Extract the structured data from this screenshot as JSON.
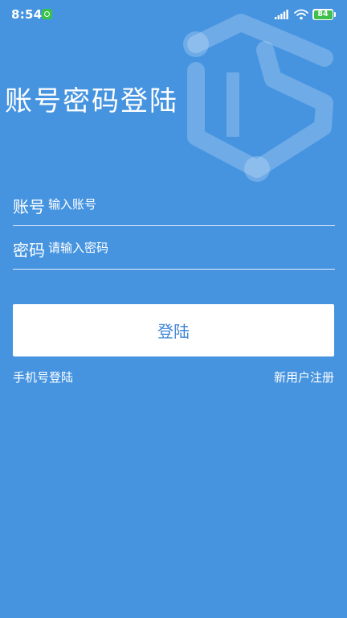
{
  "status_bar": {
    "time": "8:54",
    "battery_level": "84",
    "icons": [
      "notification-icon",
      "signal-icon",
      "wifi-icon",
      "battery-icon"
    ]
  },
  "login": {
    "title": "账号密码登陆",
    "account_label": "账号",
    "account_placeholder": "输入账号",
    "account_value": "",
    "password_label": "密码",
    "password_placeholder": "请输入密码",
    "password_value": "",
    "submit_label": "登陆"
  },
  "links": {
    "phone_login": "手机号登陆",
    "register": "新用户注册"
  },
  "colors": {
    "background": "#4694e0",
    "button_background": "#ffffff",
    "button_text": "#3f86d6",
    "battery_fill": "#3fbf4c"
  }
}
